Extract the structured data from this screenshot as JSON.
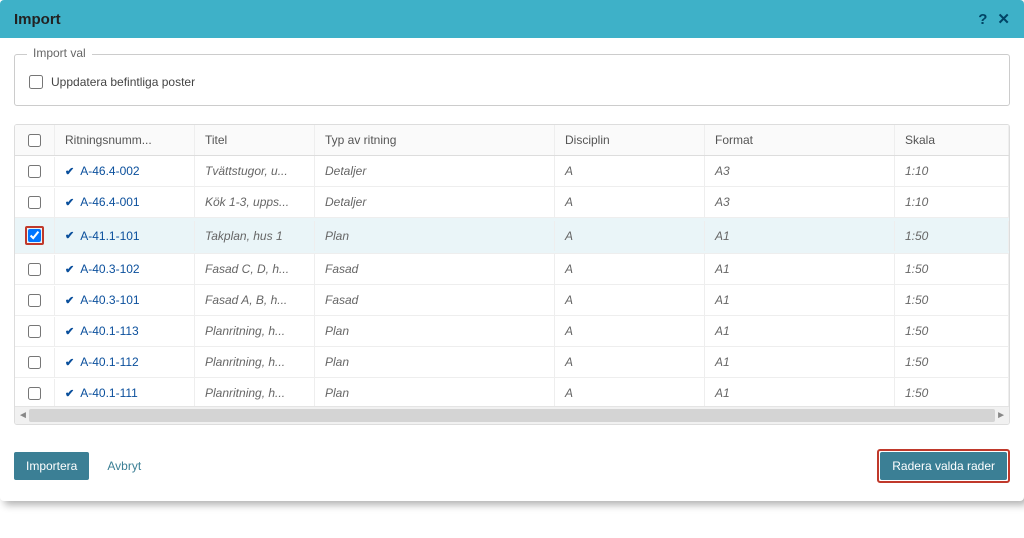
{
  "dialog": {
    "title": "Import",
    "help_icon": "?",
    "close_icon": "✕"
  },
  "import_options": {
    "legend": "Import val",
    "update_existing_label": "Uppdatera befintliga poster",
    "update_existing_checked": false
  },
  "table": {
    "headers": {
      "number": "Ritningsnumm...",
      "title": "Titel",
      "type": "Typ av ritning",
      "discipline": "Disciplin",
      "format": "Format",
      "scale": "Skala"
    },
    "rows": [
      {
        "checked": false,
        "highlighted": false,
        "number": "A-46.4-002",
        "title": "Tvättstugor, u...",
        "type": "Detaljer",
        "discipline": "A",
        "format": "A3",
        "scale": "1:10"
      },
      {
        "checked": false,
        "highlighted": false,
        "number": "A-46.4-001",
        "title": "Kök 1-3, upps...",
        "type": "Detaljer",
        "discipline": "A",
        "format": "A3",
        "scale": "1:10"
      },
      {
        "checked": true,
        "highlighted": true,
        "number": "A-41.1-101",
        "title": "Takplan, hus 1",
        "type": "Plan",
        "discipline": "A",
        "format": "A1",
        "scale": "1:50"
      },
      {
        "checked": false,
        "highlighted": false,
        "number": "A-40.3-102",
        "title": "Fasad C, D, h...",
        "type": "Fasad",
        "discipline": "A",
        "format": "A1",
        "scale": "1:50"
      },
      {
        "checked": false,
        "highlighted": false,
        "number": "A-40.3-101",
        "title": "Fasad A, B, h...",
        "type": "Fasad",
        "discipline": "A",
        "format": "A1",
        "scale": "1:50"
      },
      {
        "checked": false,
        "highlighted": false,
        "number": "A-40.1-113",
        "title": "Planritning, h...",
        "type": "Plan",
        "discipline": "A",
        "format": "A1",
        "scale": "1:50"
      },
      {
        "checked": false,
        "highlighted": false,
        "number": "A-40.1-112",
        "title": "Planritning, h...",
        "type": "Plan",
        "discipline": "A",
        "format": "A1",
        "scale": "1:50"
      },
      {
        "checked": false,
        "highlighted": false,
        "number": "A-40.1-111",
        "title": "Planritning, h...",
        "type": "Plan",
        "discipline": "A",
        "format": "A1",
        "scale": "1:50"
      }
    ]
  },
  "footer": {
    "import_label": "Importera",
    "cancel_label": "Avbryt",
    "delete_label": "Radera valda rader"
  }
}
